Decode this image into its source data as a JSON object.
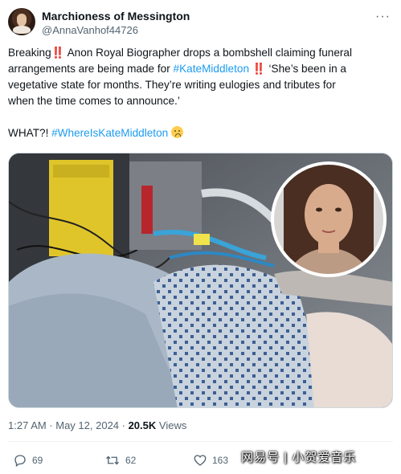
{
  "tweet": {
    "author_name": "Marchioness of Messington",
    "author_handle": "@AnnaVanhof44726",
    "text": {
      "l1_a": "Breaking",
      "l1_excl": "‼️",
      "l1_b": " Anon Royal Biographer drops a bombshell claiming funeral",
      "l2_a": "arrangements are being made for ",
      "l2_hash": "#KateMiddleton",
      "l2_b": " ‼️ ‘She’s been in a",
      "l3": "vegetative state for months. They’re writing eulogies and tributes for",
      "l4": "when the time comes to announce.’",
      "l5_a": "WHAT?! ",
      "l5_hash": "#WhereIsKateMiddleton",
      "l5_emoji": "worried-face"
    },
    "timestamp": "1:27 AM · May 12, 2024 · ",
    "views_count": "20.5K",
    "views_label": " Views",
    "replies": "69",
    "reposts": "62",
    "likes": "163"
  },
  "watermark": "网易号 | 小贺爱音乐",
  "icons": [
    "more-icon",
    "reply-icon",
    "repost-icon",
    "like-icon"
  ],
  "colors": {
    "link": "#1d9bf0",
    "secondary": "#536471",
    "accent_red": "#d0161b"
  }
}
